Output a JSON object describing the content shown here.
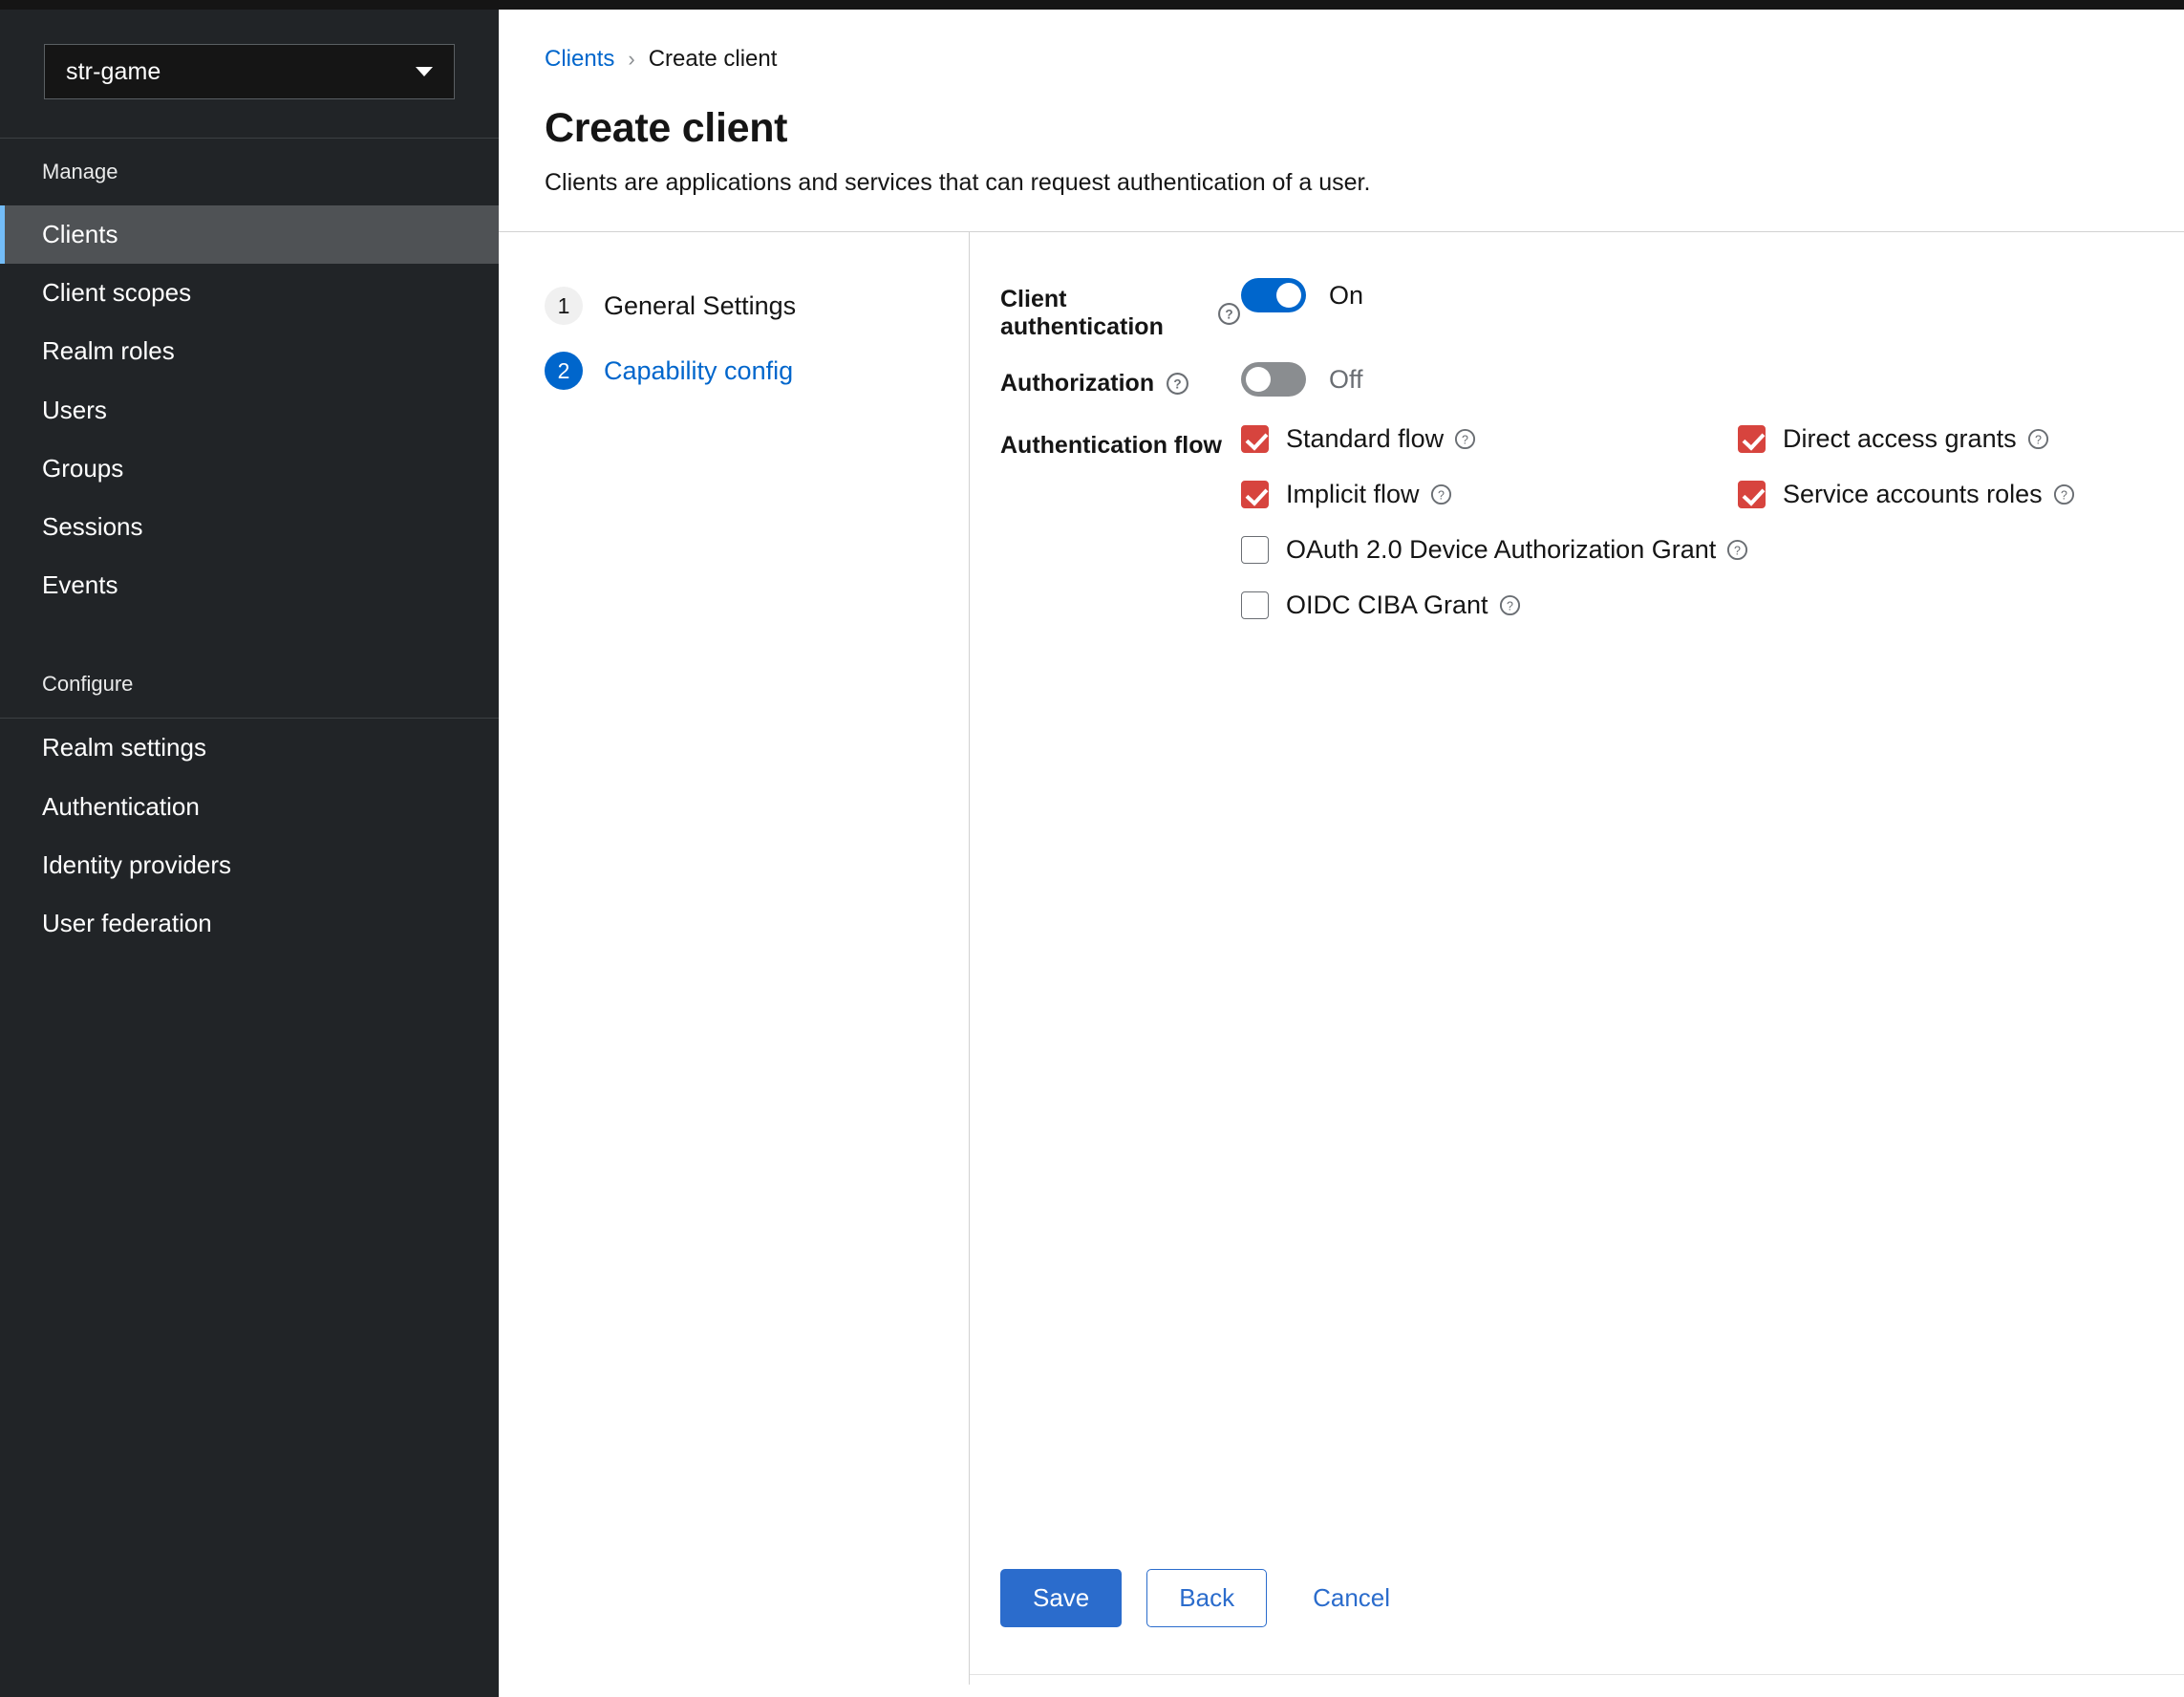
{
  "masthead": {
    "present": true
  },
  "sidebar": {
    "realm_selector": {
      "value": "str-game",
      "caret_icon": "chevron-down-icon"
    },
    "sections": [
      {
        "title": "Manage",
        "items": [
          {
            "label": "Clients",
            "active": true
          },
          {
            "label": "Client scopes",
            "active": false
          },
          {
            "label": "Realm roles",
            "active": false
          },
          {
            "label": "Users",
            "active": false
          },
          {
            "label": "Groups",
            "active": false
          },
          {
            "label": "Sessions",
            "active": false
          },
          {
            "label": "Events",
            "active": false
          }
        ]
      },
      {
        "title": "Configure",
        "items": [
          {
            "label": "Realm settings",
            "active": false
          },
          {
            "label": "Authentication",
            "active": false
          },
          {
            "label": "Identity providers",
            "active": false
          },
          {
            "label": "User federation",
            "active": false
          }
        ]
      }
    ]
  },
  "header": {
    "breadcrumb": {
      "parent": "Clients",
      "separator": "›",
      "current": "Create client"
    },
    "title": "Create client",
    "subtitle": "Clients are applications and services that can request authentication of a user."
  },
  "wizard": {
    "steps": [
      {
        "number": "1",
        "label": "General Settings",
        "active": false
      },
      {
        "number": "2",
        "label": "Capability config",
        "active": true
      }
    ],
    "fields": {
      "client_authentication": {
        "label": "Client authentication",
        "help_icon": "help-circle-icon",
        "state": "on",
        "state_text": "On"
      },
      "authorization": {
        "label": "Authorization",
        "help_icon": "help-circle-icon",
        "state": "off",
        "state_text": "Off"
      },
      "authentication_flow": {
        "label": "Authentication flow",
        "rows": [
          [
            {
              "label": "Standard flow",
              "checked": true,
              "help_icon": "help-circle-icon"
            },
            {
              "label": "Direct access grants",
              "checked": true,
              "help_icon": "help-circle-icon"
            }
          ],
          [
            {
              "label": "Implicit flow",
              "checked": true,
              "help_icon": "help-circle-icon"
            },
            {
              "label": "Service accounts roles",
              "checked": true,
              "help_icon": "help-circle-icon"
            }
          ],
          [
            {
              "label": "OAuth 2.0 Device Authorization Grant",
              "checked": false,
              "help_icon": "help-circle-icon"
            }
          ],
          [
            {
              "label": "OIDC CIBA Grant",
              "checked": false,
              "help_icon": "help-circle-icon"
            }
          ]
        ]
      }
    },
    "footer": {
      "save_label": "Save",
      "back_label": "Back",
      "cancel_label": "Cancel"
    }
  },
  "colors": {
    "accent_blue": "#0066cc",
    "button_blue": "#2b6ccc",
    "checkbox_red": "#d7443e",
    "sidebar_bg": "#212427",
    "sidebar_active_bg": "#4f5255",
    "sidebar_active_bar": "#73bcf7",
    "toggle_off_grey": "#8a8d90"
  }
}
